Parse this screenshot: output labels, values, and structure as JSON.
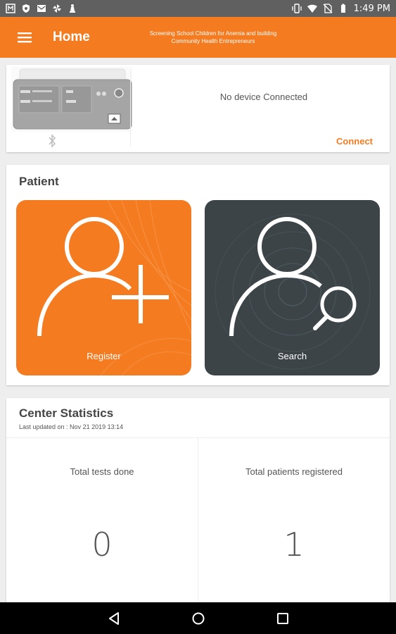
{
  "status_bar": {
    "time": "1:49 PM",
    "left_icons": [
      "media-icon",
      "shield-icon",
      "mail-icon",
      "pinwheel-icon",
      "chess-icon"
    ],
    "right_icons": [
      "vibrate-icon",
      "wifi-icon",
      "no-sim-icon",
      "battery-icon"
    ]
  },
  "app_bar": {
    "title": "Home",
    "subtitle": "Screening School Children for Anemia and building Community Health Entrepreneurs",
    "color": "#f47b20"
  },
  "device": {
    "status": "No device Connected",
    "connect_label": "Connect",
    "icon": "bluetooth-icon"
  },
  "patient": {
    "title": "Patient",
    "register_label": "Register",
    "search_label": "Search",
    "register_color": "#f47b20",
    "search_color": "#3d4448"
  },
  "stats": {
    "title": "Center Statistics",
    "last_updated": "Last updated on : Nov 21 2019 13:14",
    "tests_label": "Total tests done",
    "tests_value": "0",
    "patients_label": "Total patients registered",
    "patients_value": "1"
  },
  "nav": {
    "icons": [
      "back-icon",
      "home-icon",
      "recent-apps-icon"
    ]
  }
}
